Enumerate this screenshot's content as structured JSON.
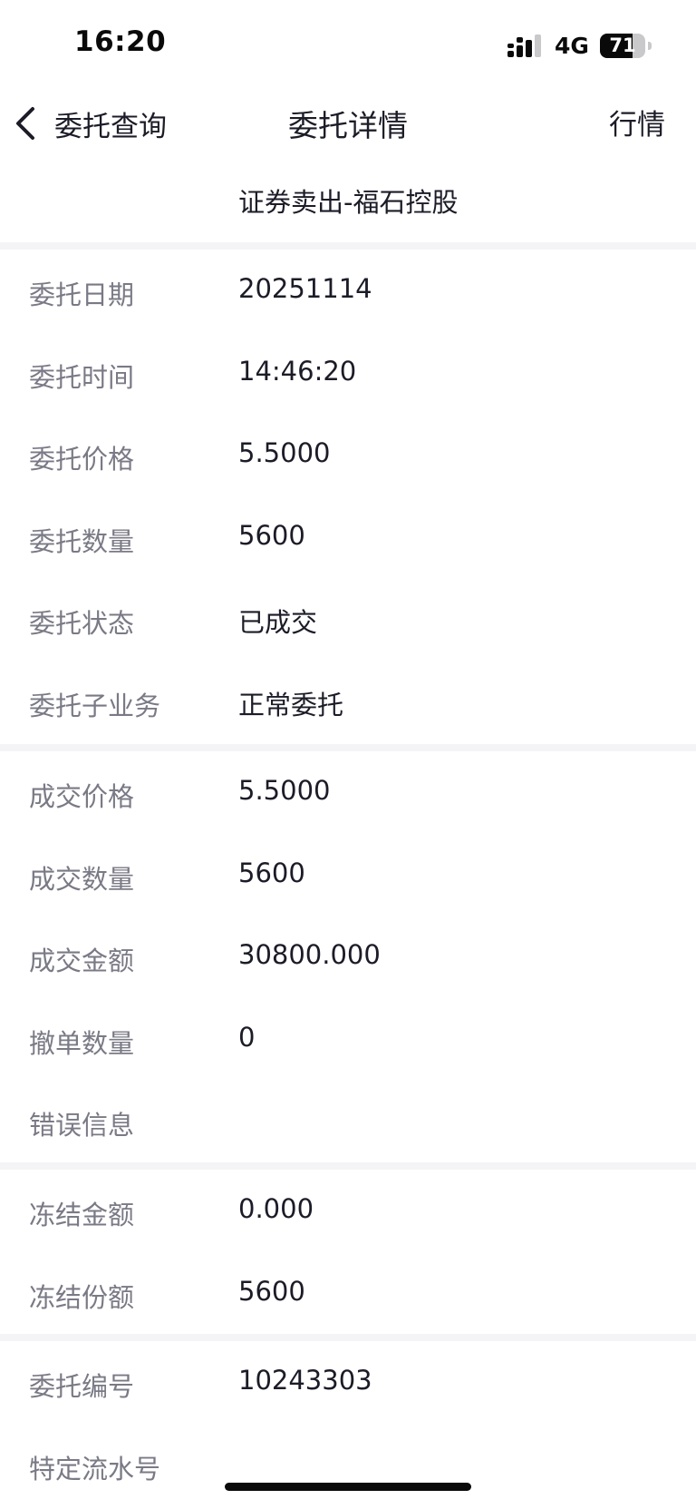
{
  "status_bar": {
    "time": "16:20",
    "network": "4G",
    "battery_level": "71",
    "battery_fraction": 0.71
  },
  "nav": {
    "back_label": "委托查询",
    "title": "委托详情",
    "right_label": "行情"
  },
  "order_subtitle": "证券卖出-福石控股",
  "sections": [
    {
      "rows": [
        {
          "label": "委托日期",
          "value": "20251114"
        },
        {
          "label": "委托时间",
          "value": "14:46:20"
        },
        {
          "label": "委托价格",
          "value": "5.5000"
        },
        {
          "label": "委托数量",
          "value": "5600"
        },
        {
          "label": "委托状态",
          "value": "已成交"
        },
        {
          "label": "委托子业务",
          "value": "正常委托"
        }
      ]
    },
    {
      "rows": [
        {
          "label": "成交价格",
          "value": "5.5000"
        },
        {
          "label": "成交数量",
          "value": "5600"
        },
        {
          "label": "成交金额",
          "value": "30800.000"
        },
        {
          "label": "撤单数量",
          "value": "0"
        },
        {
          "label": "错误信息",
          "value": ""
        }
      ]
    },
    {
      "rows": [
        {
          "label": "冻结金额",
          "value": "0.000"
        },
        {
          "label": "冻结份额",
          "value": "5600"
        }
      ]
    },
    {
      "rows": [
        {
          "label": "委托编号",
          "value": "10243303"
        },
        {
          "label": "特定流水号",
          "value": ""
        }
      ]
    }
  ]
}
